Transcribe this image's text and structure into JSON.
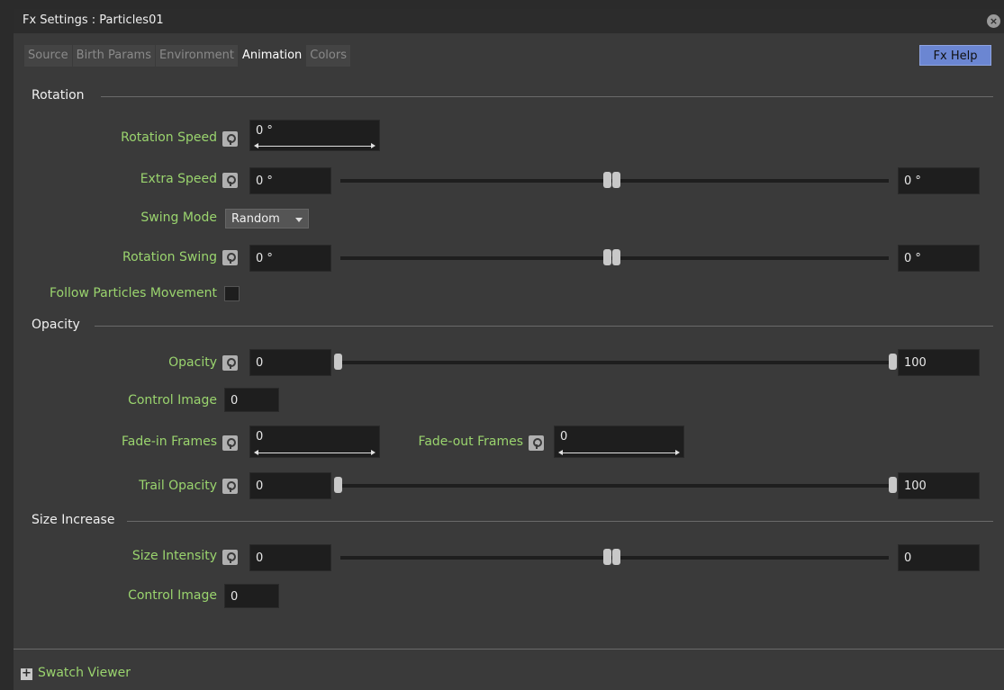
{
  "window": {
    "title": "Fx Settings : Particles01"
  },
  "tabs": [
    {
      "label": "Source",
      "active": false
    },
    {
      "label": "Birth Params",
      "active": false
    },
    {
      "label": "Environment",
      "active": false
    },
    {
      "label": "Animation",
      "active": true
    },
    {
      "label": "Colors",
      "active": false
    }
  ],
  "help_button": "Fx Help",
  "sections": {
    "rotation": "Rotation",
    "opacity": "Opacity",
    "size_increase": "Size Increase"
  },
  "rotation": {
    "rotation_speed": {
      "label": "Rotation Speed",
      "value": "0 °"
    },
    "extra_speed": {
      "label": "Extra Speed",
      "min": "0 °",
      "max": "0 °",
      "level": 0.5
    },
    "swing_mode": {
      "label": "Swing Mode",
      "value": "Random"
    },
    "rotation_swing": {
      "label": "Rotation Swing",
      "min": "0 °",
      "max": "0 °",
      "level": 0.5
    },
    "follow_particles": {
      "label": "Follow Particles Movement",
      "checked": false
    }
  },
  "opacity": {
    "opacity": {
      "label": "Opacity",
      "min": "0",
      "max": "100"
    },
    "control_image": {
      "label": "Control Image",
      "value": "0"
    },
    "fade_in": {
      "label": "Fade-in Frames",
      "value": "0"
    },
    "fade_out": {
      "label": "Fade-out Frames",
      "value": "0"
    },
    "trail_opacity": {
      "label": "Trail Opacity",
      "min": "0",
      "max": "100"
    }
  },
  "size_increase": {
    "size_intensity": {
      "label": "Size Intensity",
      "min": "0",
      "max": "0",
      "level": 0.5
    },
    "control_image": {
      "label": "Control Image",
      "value": "0"
    }
  },
  "footer": {
    "swatch_viewer": "Swatch Viewer"
  },
  "colors": {
    "label_green": "#9ad46e",
    "help_blue": "#6b86d2",
    "field_bg": "#1e1e1e",
    "panel_bg": "#3a3a3a"
  },
  "icons": {
    "key": "key-icon",
    "close": "close-icon",
    "expand": "plus-icon",
    "dropdown": "chevron-down-icon"
  }
}
